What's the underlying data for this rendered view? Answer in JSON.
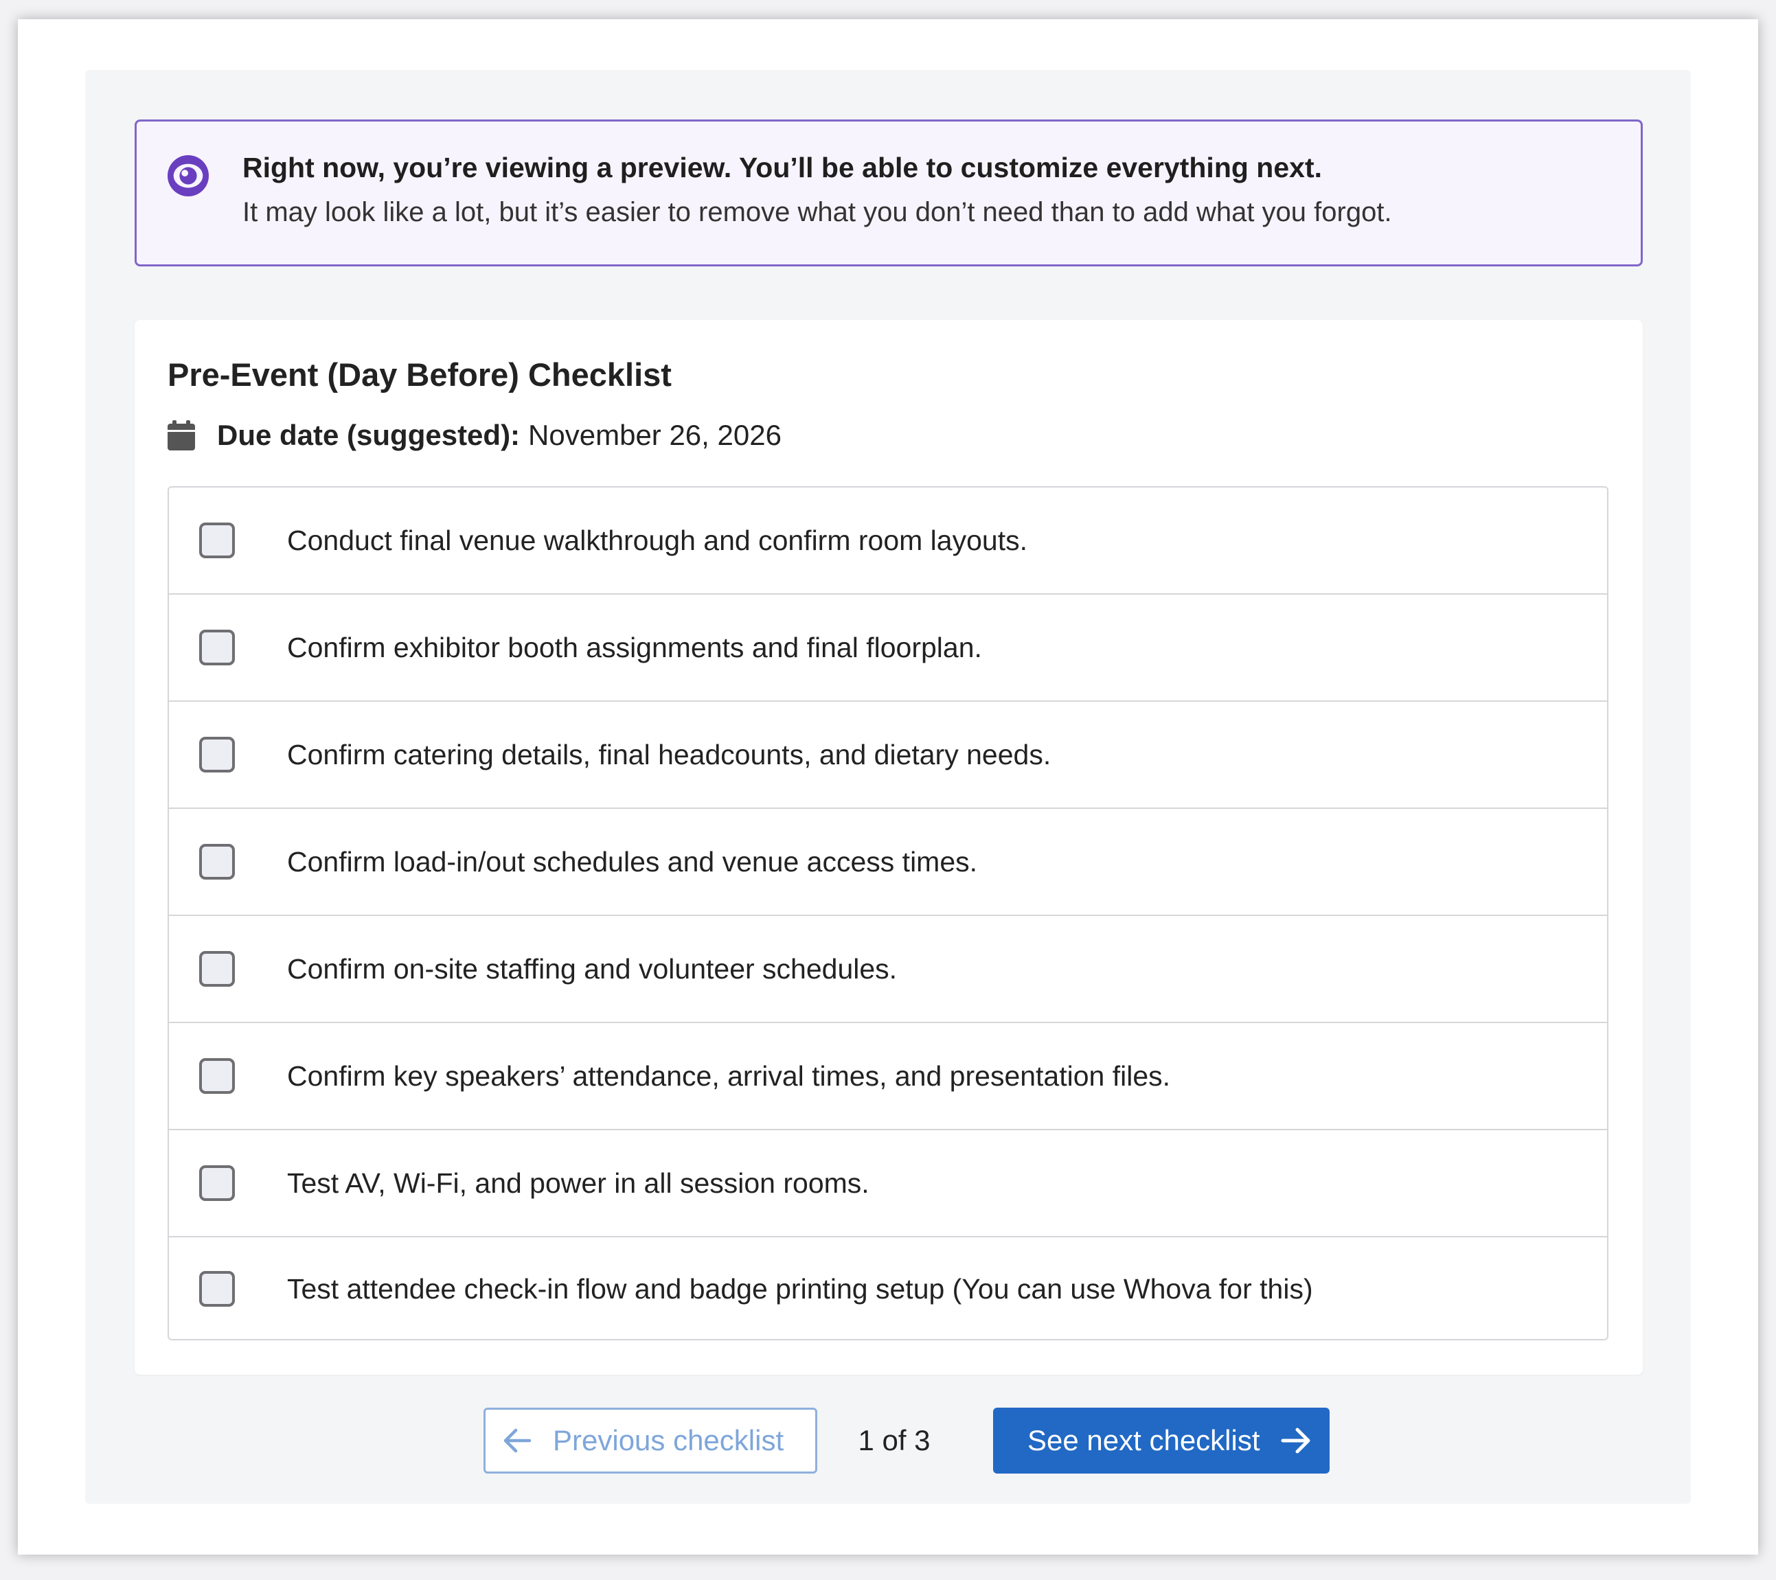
{
  "notice": {
    "icon": "eye-icon",
    "title": "Right now, you’re viewing a preview. You’ll be able to customize everything next.",
    "body": "It may look like a lot, but it’s easier to remove what you don’t need than to add what you forgot.",
    "border_color": "#8066c9",
    "icon_color": "#6a3fbf"
  },
  "checklist": {
    "title": "Pre-Event (Day Before) Checklist",
    "due_icon": "calendar-icon",
    "due_label": "Due date (suggested):",
    "due_value": "November 26, 2026",
    "items": [
      {
        "text": "Conduct final venue walkthrough and confirm room layouts.",
        "checked": false
      },
      {
        "text": "Confirm exhibitor booth assignments and final floorplan.",
        "checked": false
      },
      {
        "text": "Confirm catering details, final headcounts, and dietary needs.",
        "checked": false
      },
      {
        "text": "Confirm load-in/out schedules and venue access times.",
        "checked": false
      },
      {
        "text": "Confirm on-site staffing and volunteer schedules.",
        "checked": false
      },
      {
        "text": "Confirm key speakers’ attendance, arrival times, and presentation files.",
        "checked": false
      },
      {
        "text": "Test AV, Wi-Fi, and power in all session rooms.",
        "checked": false
      },
      {
        "text": "Test attendee check-in flow and badge printing setup (You can use Whova for this)",
        "checked": false
      }
    ]
  },
  "pager": {
    "prev_label": "Previous checklist",
    "prev_icon": "arrow-left-icon",
    "page_indicator": "1 of 3",
    "next_label": "See next checklist",
    "next_icon": "arrow-right-icon",
    "primary_color": "#2169c4"
  }
}
